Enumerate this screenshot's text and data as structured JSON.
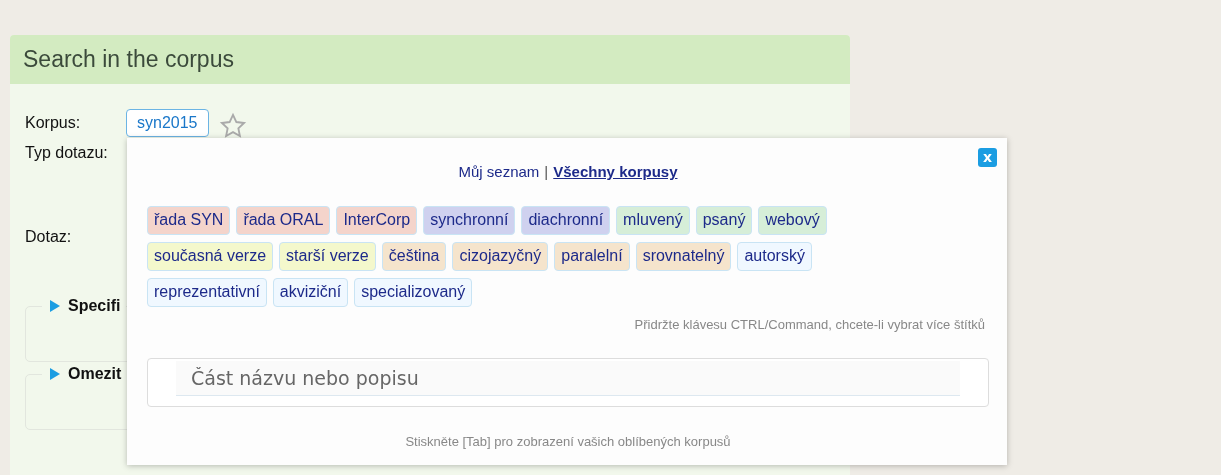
{
  "panel": {
    "title": "Search in the corpus",
    "corpus_label": "Korpus:",
    "corpus": "syn2015",
    "favorite": false,
    "query_type_label": "Typ dotazu:",
    "query_label": "Dotaz:",
    "sections": [
      {
        "label": "Specifi",
        "expanded": false
      },
      {
        "label": "Omezit",
        "expanded": false
      }
    ]
  },
  "popup": {
    "tabs": [
      {
        "label": "Můj seznam",
        "selected": false
      },
      {
        "label": "Všechny korpusy",
        "selected": true
      }
    ],
    "separator": "|",
    "close": "x",
    "tags": [
      {
        "label": "řada SYN",
        "color": "#f4d4cb"
      },
      {
        "label": "řada ORAL",
        "color": "#f4d4cb"
      },
      {
        "label": "InterCorp",
        "color": "#f4d4cb"
      },
      {
        "label": "synchronní",
        "color": "#cfd1ef"
      },
      {
        "label": "diachronní",
        "color": "#cfd1ef"
      },
      {
        "label": "mluvený",
        "color": "#d6eed8"
      },
      {
        "label": "psaný",
        "color": "#d6eed8"
      },
      {
        "label": "webový",
        "color": "#d6eed8"
      },
      {
        "label": "současná verze",
        "color": "#f4f8cc"
      },
      {
        "label": "starší verze",
        "color": "#f4f8cc"
      },
      {
        "label": "čeština",
        "color": "#f5e4cc"
      },
      {
        "label": "cizojazyčný",
        "color": "#f5e4cc"
      },
      {
        "label": "paralelní",
        "color": "#f5e4cc"
      },
      {
        "label": "srovnatelný",
        "color": "#f5e4cc"
      },
      {
        "label": "autorský",
        "color": "#f0f8ff"
      },
      {
        "label": "reprezentativní",
        "color": "#f0f8ff"
      },
      {
        "label": "akviziční",
        "color": "#f0f8ff"
      },
      {
        "label": "specializovaný",
        "color": "#f0f8ff"
      }
    ],
    "hint": "Přidržte klávesu CTRL/Command, chcete-li vybrat více štítků",
    "search": {
      "placeholder": "Část názvu nebo popisu"
    },
    "footer": "Stiskněte [Tab] pro zobrazení vašich oblíbených korpusů"
  }
}
